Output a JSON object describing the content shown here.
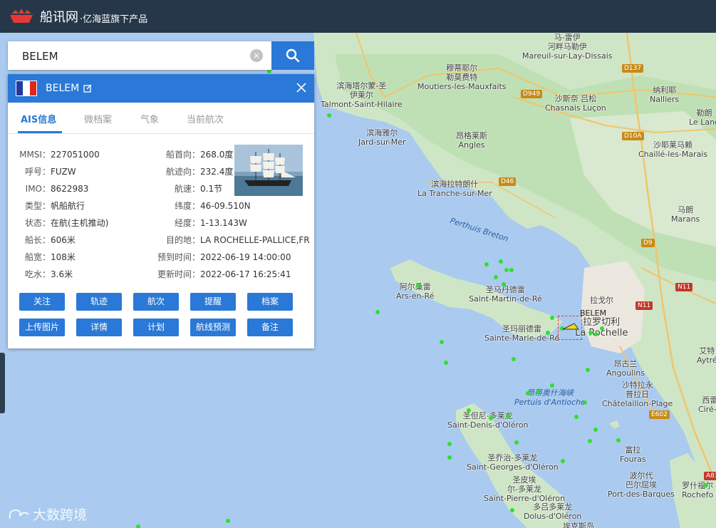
{
  "header": {
    "brand": "船讯网",
    "subtitle": "·亿海蓝旗下产品"
  },
  "search": {
    "value": "BELEM",
    "clear_icon": "×"
  },
  "ship": {
    "name": "BELEM",
    "flag_colors": [
      "#1f3aa0",
      "#ffffff",
      "#e1261c"
    ],
    "tabs": [
      "AIS信息",
      "微档案",
      "气象",
      "当前航次"
    ],
    "left_fields": [
      {
        "label": "MMSI：",
        "value": "227051000"
      },
      {
        "label": "呼号：",
        "value": "FUZW"
      },
      {
        "label": "IMO：",
        "value": "8622983"
      },
      {
        "label": "类型：",
        "value": "帆船航行"
      },
      {
        "label": "状态：",
        "value": "在航(主机推动)"
      },
      {
        "label": "船长：",
        "value": "606米"
      },
      {
        "label": "船宽：",
        "value": "108米"
      },
      {
        "label": "吃水：",
        "value": "3.6米"
      }
    ],
    "right_fields": [
      {
        "label": "船首向：",
        "value": "268.0度"
      },
      {
        "label": "航迹向：",
        "value": "232.4度"
      },
      {
        "label": "航速：",
        "value": "0.1节"
      },
      {
        "label": "纬度：",
        "value": "46-09.510N"
      },
      {
        "label": "经度：",
        "value": "1-13.143W"
      },
      {
        "label": "目的地：",
        "value": "LA ROCHELLE-PALLICE,FR"
      },
      {
        "label": "预到时间：",
        "value": "2022-06-19 14:00:00"
      },
      {
        "label": "更新时间：",
        "value": "2022-06-17 16:25:41"
      }
    ],
    "actions_row1": [
      "关注",
      "轨迹",
      "航次",
      "提醒",
      "档案"
    ],
    "actions_row2": [
      "上传图片",
      "详情",
      "计划",
      "航线预测",
      "备注"
    ]
  },
  "map": {
    "labels": [
      {
        "text": "滨海塔尔蒙-圣\n伊莱尔\nTalmont-Saint-Hilaire"
      },
      {
        "text": "穆蒂耶尔\n勒莫费特\nMoutiers-les-Mauxfaits"
      },
      {
        "text": "马-雷伊\n河畔马勒伊\nMareuil-sur-Lay-Dissais"
      },
      {
        "text": "沙斯奈 吕松\nChasnais  Luçon"
      },
      {
        "text": "纳利耶\nNalliers"
      },
      {
        "text": "勒朗\nLe Lang"
      },
      {
        "text": "滨海雅尔\nJard-sur-Mer"
      },
      {
        "text": "昂格莱斯\nAngles"
      },
      {
        "text": "沙耶莱马赖\nChaillé-les-Marais"
      },
      {
        "text": "滨海拉特朗什\nLa Tranche-sur-Mer"
      },
      {
        "text": "马朗\nMarans"
      },
      {
        "text": "阿尔桑雷\nArs-en-Ré"
      },
      {
        "text": "圣马丹德雷\nSaint-Martin-de-Ré"
      },
      {
        "text": "圣玛丽德雷\nSainte-Marie-de-Ré"
      },
      {
        "text": "拉戈尔"
      },
      {
        "text": "拉罗切利\nLa Rochelle"
      },
      {
        "text": "艾特\nAytré"
      },
      {
        "text": "昂古兰\nAngoulins"
      },
      {
        "text": "沙特拉永\n普拉日\nChâtelaillon-Plage"
      },
      {
        "text": "西雷\nCiré-d"
      },
      {
        "text": "昂蒂奥什海峡\nPertuis d'Antioche"
      },
      {
        "text": "圣但尼-多莱龙\nSaint-Denis-d'Oléron"
      },
      {
        "text": "圣乔治-多莱龙\nSaint-Georges-d'Oléron"
      },
      {
        "text": "富拉\nFouras"
      },
      {
        "text": "波尔代\n巴尔屈埃\nPort-des-Barques"
      },
      {
        "text": "罗什福尔\nRochefo"
      },
      {
        "text": "圣皮埃\n尔-多莱龙\nSaint-Pierre-d'Oléron"
      },
      {
        "text": "多吕多莱龙\nDolus-d'Oléron"
      },
      {
        "text": "埃克斯岛\nÎle d'Aix"
      },
      {
        "text": "Perthuis Breton"
      }
    ],
    "roads": [
      "D137",
      "D949",
      "D10A",
      "D46",
      "D9",
      "N11",
      "N11",
      "E602",
      "A83"
    ],
    "target_label": "BELEM"
  },
  "watermark": "大数跨境"
}
